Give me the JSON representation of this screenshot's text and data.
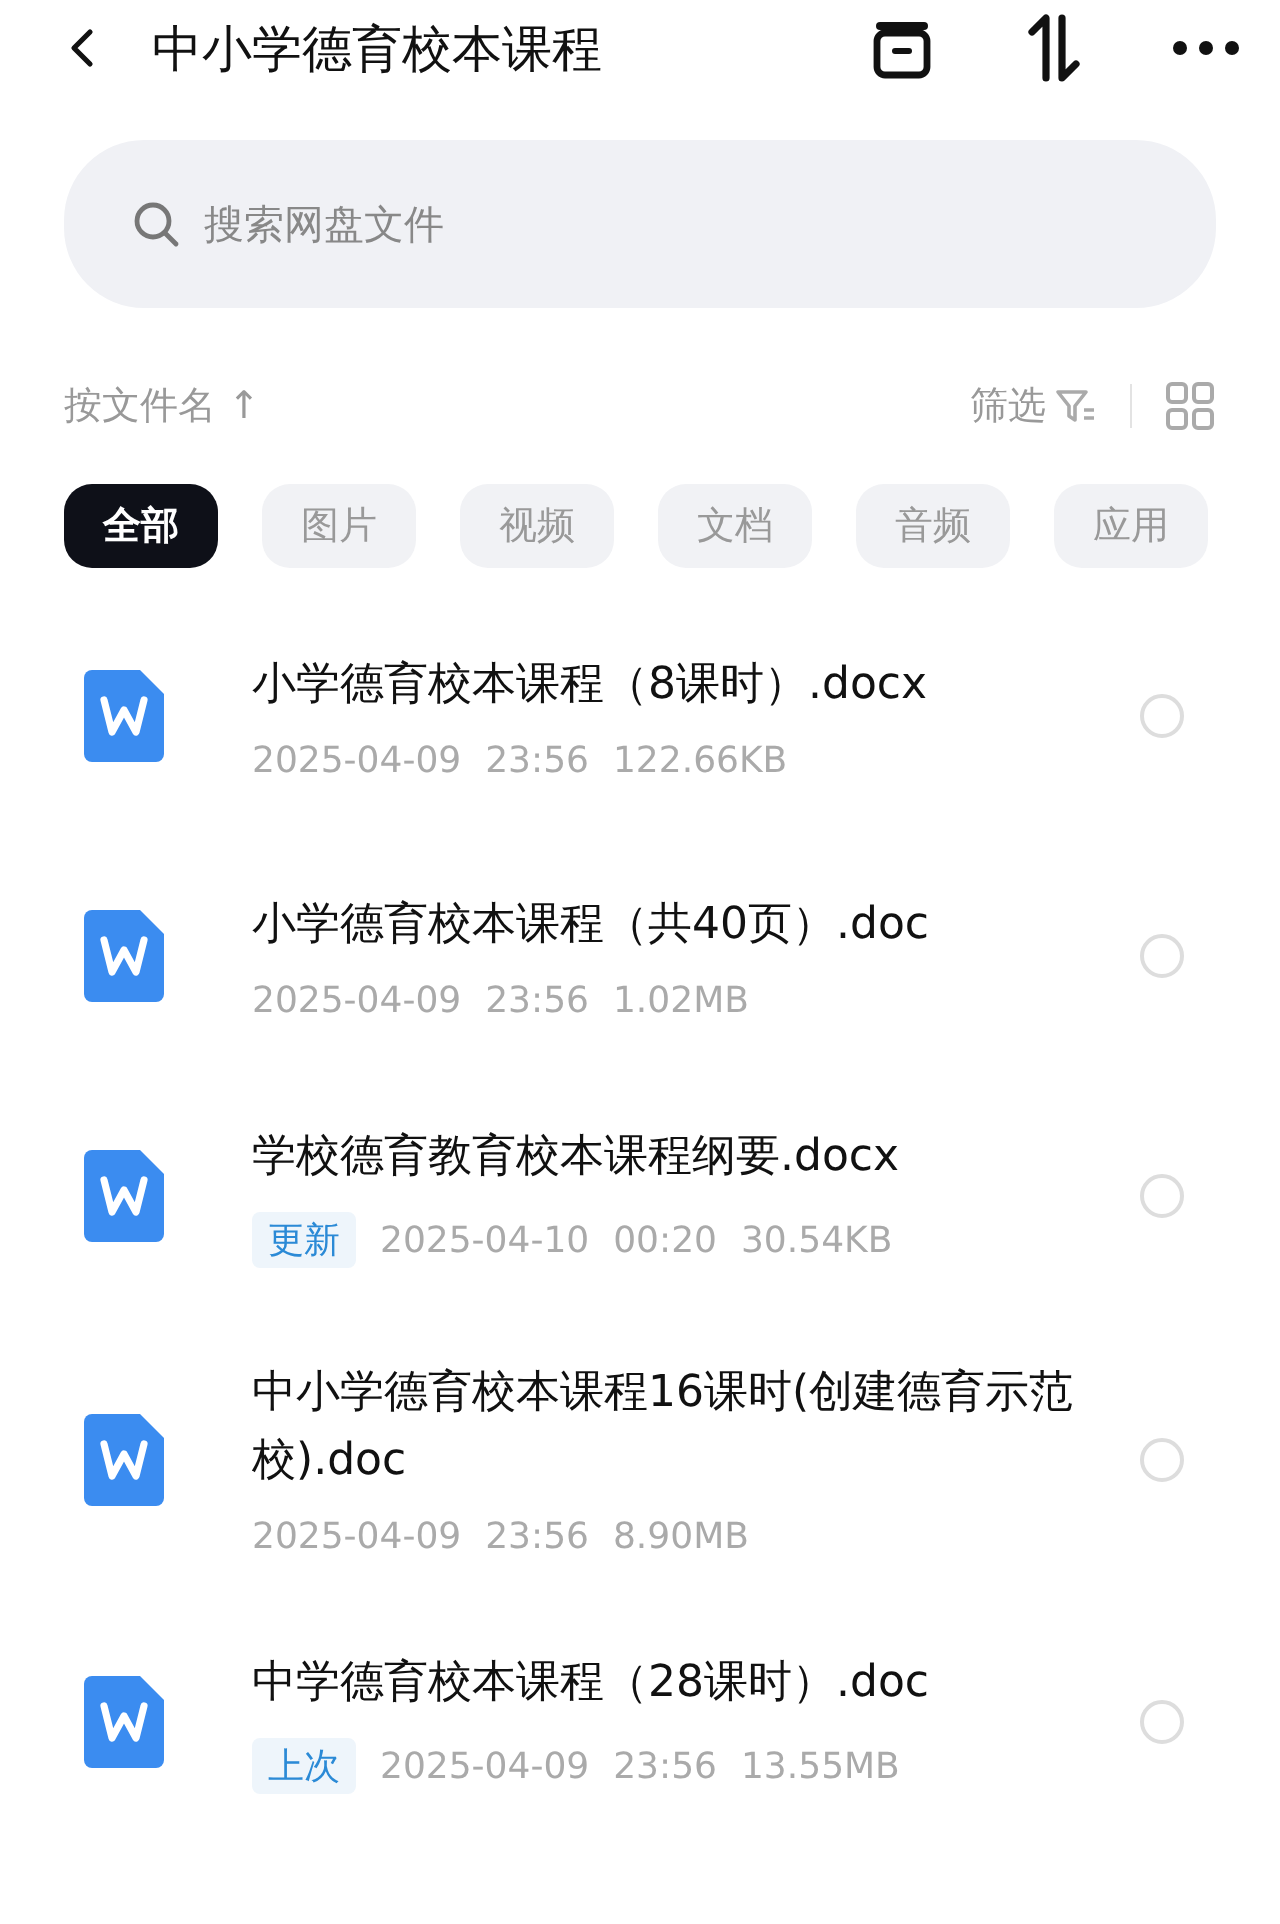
{
  "header": {
    "title": "中小学德育校本课程"
  },
  "search": {
    "placeholder": "搜索网盘文件"
  },
  "sort": {
    "label": "按文件名",
    "arrow": "↑"
  },
  "filter": {
    "label": "筛选"
  },
  "tabs": [
    {
      "label": "全部",
      "selected": true
    },
    {
      "label": "图片",
      "selected": false
    },
    {
      "label": "视频",
      "selected": false
    },
    {
      "label": "文档",
      "selected": false
    },
    {
      "label": "音频",
      "selected": false
    },
    {
      "label": "应用",
      "selected": false
    }
  ],
  "files": [
    {
      "name": "小学德育校本课程（8课时）.docx",
      "date": "2025-04-09",
      "time": "23:56",
      "size": "122.66KB",
      "selected": false
    },
    {
      "name": "小学德育校本课程（共40页）.doc",
      "date": "2025-04-09",
      "time": "23:56",
      "size": "1.02MB",
      "selected": false
    },
    {
      "name": "学校德育教育校本课程纲要.docx",
      "tag": "更新",
      "date": "2025-04-10",
      "time": "00:20",
      "size": "30.54KB",
      "selected": false
    },
    {
      "name": "中小学德育校本课程16课时(创建德育示范校).doc",
      "date": "2025-04-09",
      "time": "23:56",
      "size": "8.90MB",
      "selected": false
    },
    {
      "name": "中学德育校本课程（28课时）.doc",
      "tag": "上次",
      "date": "2025-04-09",
      "time": "23:56",
      "size": "13.55MB",
      "selected": false
    }
  ]
}
